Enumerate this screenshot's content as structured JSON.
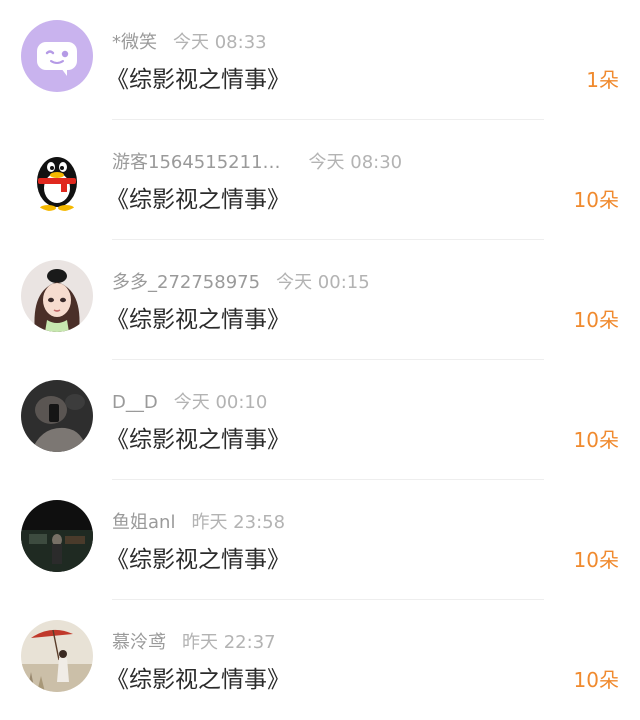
{
  "gift_list": [
    {
      "name": "*微笑",
      "time": "今天 08:33",
      "title": "《综影视之情事》",
      "gift": "1朵",
      "avatar_icon": "chat-bubble-face-icon"
    },
    {
      "name": "游客1564515211…",
      "time": "今天 08:30",
      "title": "《综影视之情事》",
      "gift": "10朵",
      "avatar_icon": "penguin-icon"
    },
    {
      "name": "多多_272758975",
      "time": "今天 00:15",
      "title": "《综影视之情事》",
      "gift": "10朵",
      "avatar_icon": "cartoon-girl-icon"
    },
    {
      "name": "D__D",
      "time": "今天 00:10",
      "title": "《综影视之情事》",
      "gift": "10朵",
      "avatar_icon": "dark-photo-avatar"
    },
    {
      "name": "鱼姐anl",
      "time": "昨天 23:58",
      "title": "《综影视之情事》",
      "gift": "10朵",
      "avatar_icon": "night-scene-avatar"
    },
    {
      "name": "慕泠鸢",
      "time": "昨天 22:37",
      "title": "《综影视之情事》",
      "gift": "10朵",
      "avatar_icon": "umbrella-girl-avatar"
    }
  ],
  "colors": {
    "gift": "#f08a2e",
    "name": "#9a9a9a",
    "title": "#2b2b2b",
    "avatar_1": "#c9b3ee"
  }
}
